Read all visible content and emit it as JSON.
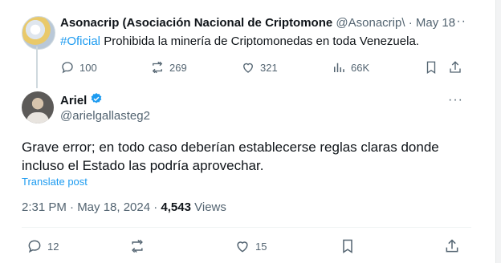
{
  "parent_tweet": {
    "author_name": "Asonacrip (Asociación Nacional de Criptomone",
    "author_handle": "@Asonacrip\\",
    "separator": "·",
    "date": "May 18",
    "hashtag": "#Oficial",
    "text": " Prohibida la minería de Criptomonedas en toda Venezuela.",
    "more_glyph": "···",
    "stats": {
      "replies": "100",
      "retweets": "269",
      "likes": "321",
      "views": "66K"
    }
  },
  "reply_tweet": {
    "author_name": "Ariel",
    "author_handle": "@arielgallasteg2",
    "more_glyph": "···",
    "text": "Grave error; en todo caso deberían establecerse reglas claras donde incluso el Estado las podría aprovechar.",
    "translate_label": "Translate post",
    "time": "2:31 PM · May 18, 2024 · ",
    "views_count": "4,543",
    "views_label": " Views",
    "stats": {
      "replies": "12",
      "likes": "15"
    }
  },
  "colors": {
    "accent": "#1d9bf0",
    "text_primary": "#0f1419",
    "text_secondary": "#536471"
  },
  "icons": [
    "reply-icon",
    "retweet-icon",
    "like-icon",
    "views-icon",
    "bookmark-icon",
    "share-icon",
    "verified-badge-icon",
    "more-icon"
  ]
}
